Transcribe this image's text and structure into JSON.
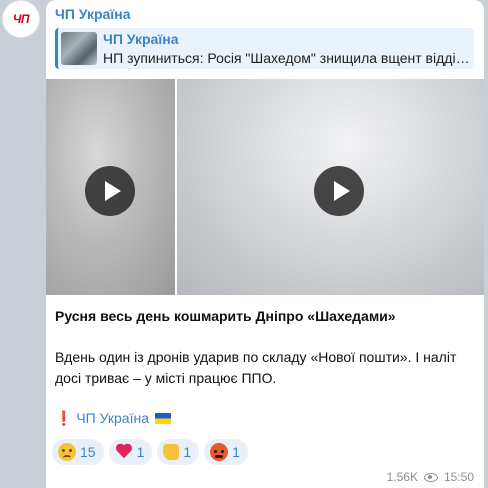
{
  "avatar": {
    "text": "ЧП"
  },
  "channel": {
    "name": "ЧП Україна"
  },
  "reply": {
    "title": "ЧП Україна",
    "text": "НП зупиниться: Росія \"Шахедом\" знищила вщент відділення"
  },
  "media": [
    {
      "type": "video"
    },
    {
      "type": "video"
    }
  ],
  "message": {
    "headline": "Русня весь день кошмарить Дніпро «Шахедами»",
    "body": "Вдень один із дронів ударив по складу «Нової пошти». І наліт досі триває – у місті працює ППО.",
    "signature_mark": "❗",
    "signature_link": "ЧП Україна"
  },
  "reactions": [
    {
      "icon": "crying-face-icon",
      "count": "15"
    },
    {
      "icon": "red-heart-icon",
      "count": "1"
    },
    {
      "icon": "thumbs-up-icon",
      "count": "1"
    },
    {
      "icon": "angry-face-icon",
      "count": "1"
    }
  ],
  "meta": {
    "views": "1.56K",
    "time": "15:50"
  },
  "colors": {
    "accent": "#3a84c4",
    "reply_bg": "#eaf3fb",
    "reaction_bg": "#e8f1fa"
  }
}
